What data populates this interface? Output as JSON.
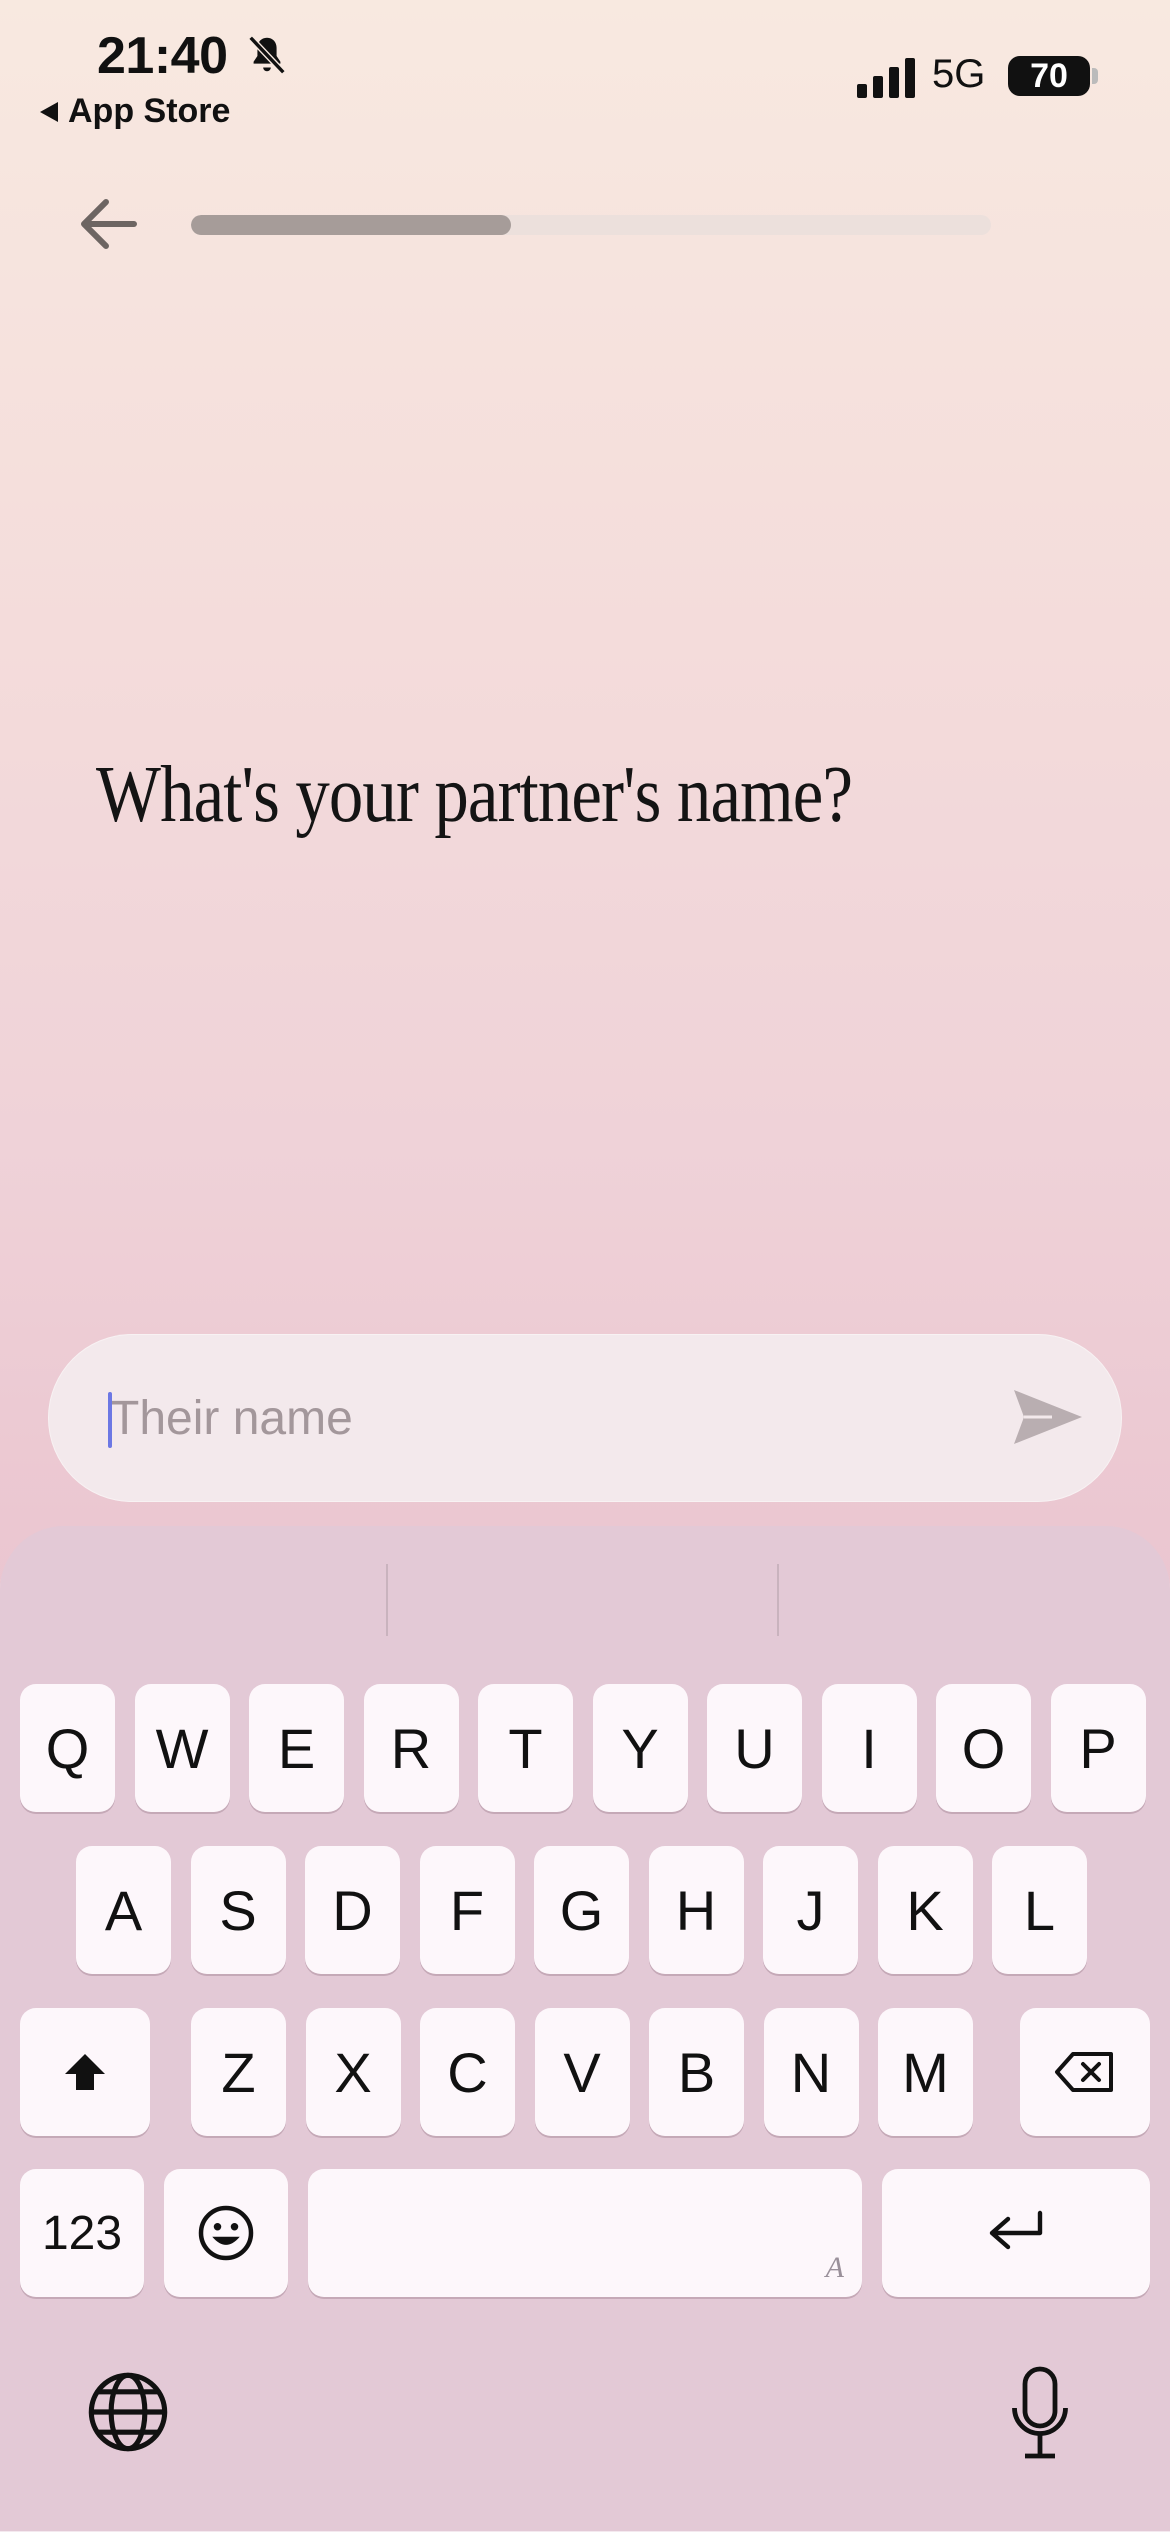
{
  "status_bar": {
    "time": "21:40",
    "back_app": "App Store",
    "network": "5G",
    "battery": "70"
  },
  "onboarding": {
    "progress_fraction": 0.4,
    "question": "What's your partner's name?",
    "input_placeholder": "Their name"
  },
  "keyboard": {
    "row1": [
      "Q",
      "W",
      "E",
      "R",
      "T",
      "Y",
      "U",
      "I",
      "O",
      "P"
    ],
    "row2": [
      "A",
      "S",
      "D",
      "F",
      "G",
      "H",
      "J",
      "K",
      "L"
    ],
    "row3": [
      "Z",
      "X",
      "C",
      "V",
      "B",
      "N",
      "M"
    ],
    "numbers_label": "123",
    "space_hint": "A"
  },
  "colors": {
    "caret": "#6c78e4",
    "progress_fill": "#a69c99"
  }
}
